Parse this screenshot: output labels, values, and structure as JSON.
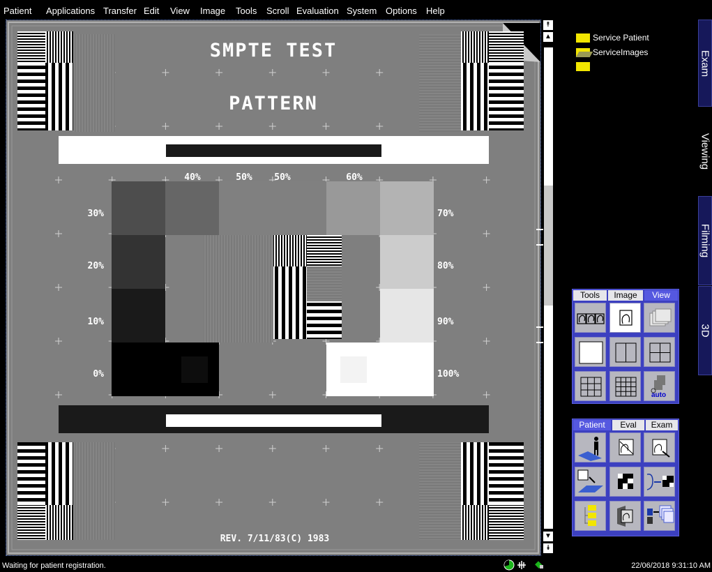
{
  "menu": [
    "Patient",
    "Applications",
    "Transfer",
    "Edit",
    "View",
    "Image",
    "Tools",
    "Scroll",
    "Evaluation",
    "System",
    "Options",
    "Help"
  ],
  "image": {
    "title_line1": "SMPTE TEST",
    "title_line2": "PATTERN",
    "revision": "REV. 7/11/83(C) 1983",
    "pct_40": "40%",
    "pct_50a": "50%",
    "pct_50b": "50%",
    "pct_60": "60%",
    "pct_30": "30%",
    "pct_20": "20%",
    "pct_10": "10%",
    "pct_0": "0%",
    "pct_70": "70%",
    "pct_80": "80%",
    "pct_90": "90%",
    "pct_100": "100%"
  },
  "tree": {
    "item1": "Service Patient",
    "item2": "ServiceImages"
  },
  "side_tabs": {
    "exam": "Exam",
    "viewing": "Viewing",
    "filming": "Filming",
    "three_d": "3D"
  },
  "view_panel": {
    "tabs": [
      "Tools",
      "Image",
      "View"
    ],
    "active_tab": "View",
    "auto_label": "auto"
  },
  "patient_panel": {
    "tabs": [
      "Patient",
      "Eval",
      "Exam"
    ],
    "active_tab": "Patient"
  },
  "status": {
    "message": "Waiting for patient registration.",
    "datetime": "22/06/2018 9:31:10 AM"
  },
  "icons": {
    "scroll_top": "double-arrow-up-icon",
    "scroll_up": "arrow-up-icon",
    "scroll_down": "arrow-down-icon",
    "scroll_bottom": "double-arrow-down-icon",
    "status": [
      "pie-clock-icon",
      "signal-icon",
      "network-icon"
    ]
  },
  "colors": {
    "panel_blue": "#3c40c0",
    "active_tab_blue": "#5558e0",
    "sidetab_navy": "#16185a",
    "folder_yellow": "#f2e600"
  }
}
